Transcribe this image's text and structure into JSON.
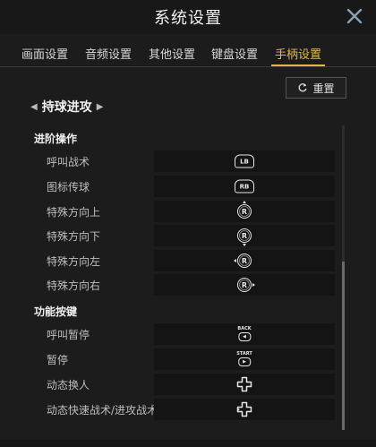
{
  "window": {
    "title": "系统设置",
    "close_icon": "close-icon"
  },
  "tabs": [
    {
      "label": "画面设置",
      "active": false
    },
    {
      "label": "音频设置",
      "active": false
    },
    {
      "label": "其他设置",
      "active": false
    },
    {
      "label": "键盘设置",
      "active": false
    },
    {
      "label": "手柄设置",
      "active": true
    }
  ],
  "reset": {
    "label": "重置",
    "icon": "reset-icon"
  },
  "scheme": {
    "name": "持球进攻",
    "prev_icon": "triangle-left-icon",
    "next_icon": "triangle-right-icon"
  },
  "sections": [
    {
      "title": "进阶操作",
      "rows": [
        {
          "label": "呼叫战术",
          "binding": "LB",
          "icon": "lb-button-icon"
        },
        {
          "label": "图标传球",
          "binding": "RB",
          "icon": "rb-button-icon"
        },
        {
          "label": "特殊方向上",
          "binding": "R",
          "icon": "right-stick-up-icon"
        },
        {
          "label": "特殊方向下",
          "binding": "R",
          "icon": "right-stick-down-icon"
        },
        {
          "label": "特殊方向左",
          "binding": "R",
          "icon": "right-stick-left-icon"
        },
        {
          "label": "特殊方向右",
          "binding": "R",
          "icon": "right-stick-right-icon"
        }
      ]
    },
    {
      "title": "功能按键",
      "rows": [
        {
          "label": "呼叫暂停",
          "binding": "BACK",
          "icon": "back-button-icon"
        },
        {
          "label": "暂停",
          "binding": "START",
          "icon": "start-button-icon"
        },
        {
          "label": "动态换人",
          "binding": "",
          "icon": "dpad-icon"
        },
        {
          "label": "动态快速战术/进攻战术",
          "binding": "",
          "icon": "dpad-icon"
        }
      ]
    }
  ],
  "colors": {
    "accent": "#e0b84a",
    "background": "#1c1c1c",
    "row_box": "#141414",
    "text": "#bdbdbd"
  }
}
